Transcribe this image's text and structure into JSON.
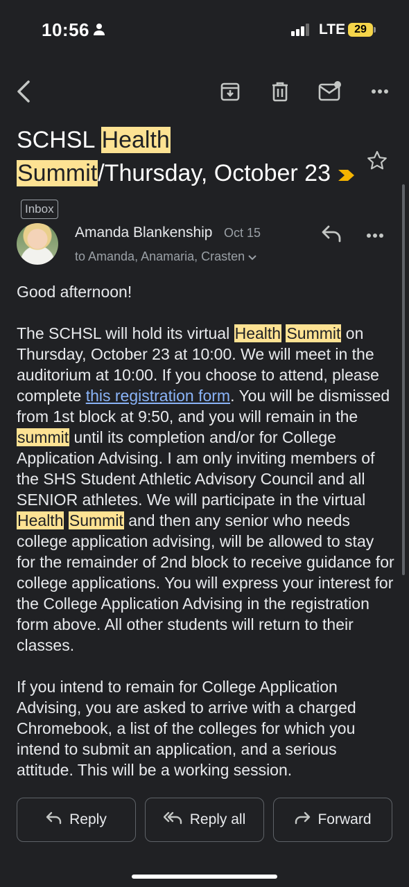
{
  "status_bar": {
    "time": "10:56",
    "network": "LTE",
    "battery": "29"
  },
  "toolbar": {
    "icons": [
      "back-arrow-icon",
      "archive-icon",
      "trash-icon",
      "mark-unread-icon",
      "more-icon"
    ]
  },
  "email": {
    "subject_parts": [
      "SCHSL ",
      "Health",
      " ",
      "Summit",
      "/Thursday, October 23"
    ],
    "label": "Inbox",
    "sender": "Amanda Blankenship",
    "date": "Oct 15",
    "recipients": "to Amanda, Anamaria, Crasten",
    "greeting": "Good afternoon!",
    "p1": {
      "a": "The SCHSL will hold its virtual ",
      "hl1": "Health",
      "b": " ",
      "hl2": "Summit",
      "c": " on Thursday, October 23 at 10:00. We will meet in the auditorium at 10:00. If you choose to attend, please complete ",
      "link": "this registration form",
      "d": ". You will be dismissed from 1st block at 9:50, and you will remain in the ",
      "hl3": "summit",
      "e": " until its completion and/or for College Application Advising. I am only inviting members of the SHS Student Athletic Advisory Council and all SENIOR athletes. We will participate in the virtual ",
      "hl4": "Health",
      "f": " ",
      "hl5": "Summit",
      "g": " and then any senior who needs college application advising, will be allowed to stay for the remainder of 2nd block to receive guidance for college applications. You will express your interest for the College Application Advising in the registration form above. All other students will return to their classes."
    },
    "p2": "If you intend to remain for College Application Advising, you are asked to arrive with a charged Chromebook, a list of the colleges for which you intend to submit an application, and a serious attitude. This will be a working session."
  },
  "actions": {
    "reply": "Reply",
    "reply_all": "Reply all",
    "forward": "Forward"
  },
  "colors": {
    "background": "#202124",
    "highlight": "#fde293",
    "link": "#8ab4f8",
    "label_arrow": "#f5b400"
  }
}
